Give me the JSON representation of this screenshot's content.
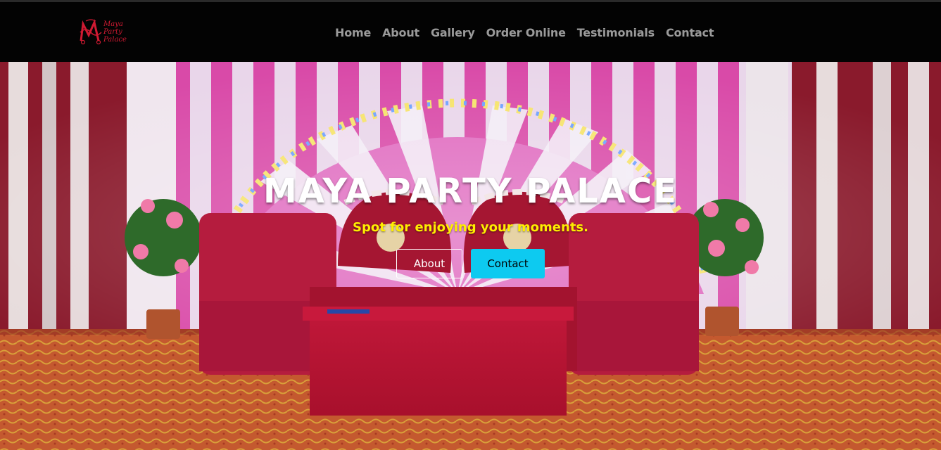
{
  "brand": {
    "logo_text_lines": [
      "Maya",
      "Party",
      "Palace"
    ],
    "logo_color": "#d01a32"
  },
  "nav": {
    "items": [
      {
        "label": "Home"
      },
      {
        "label": "About"
      },
      {
        "label": "Gallery"
      },
      {
        "label": "Order Online"
      },
      {
        "label": "Testimonials"
      },
      {
        "label": "Contact"
      }
    ]
  },
  "hero": {
    "title": "MAYA PARTY PALACE",
    "subtitle": "Spot for enjoying your moments.",
    "buttons": {
      "about_label": "About",
      "contact_label": "Contact"
    },
    "background_photo": "decorated-stage-with-red-sofas-and-pink-curtains"
  },
  "colors": {
    "navbar_bg": "#030303",
    "nav_text": "#9a9a9a",
    "title": "#ffffff",
    "subtitle": "#ffee00",
    "contact_button": "#0dcaf0"
  }
}
